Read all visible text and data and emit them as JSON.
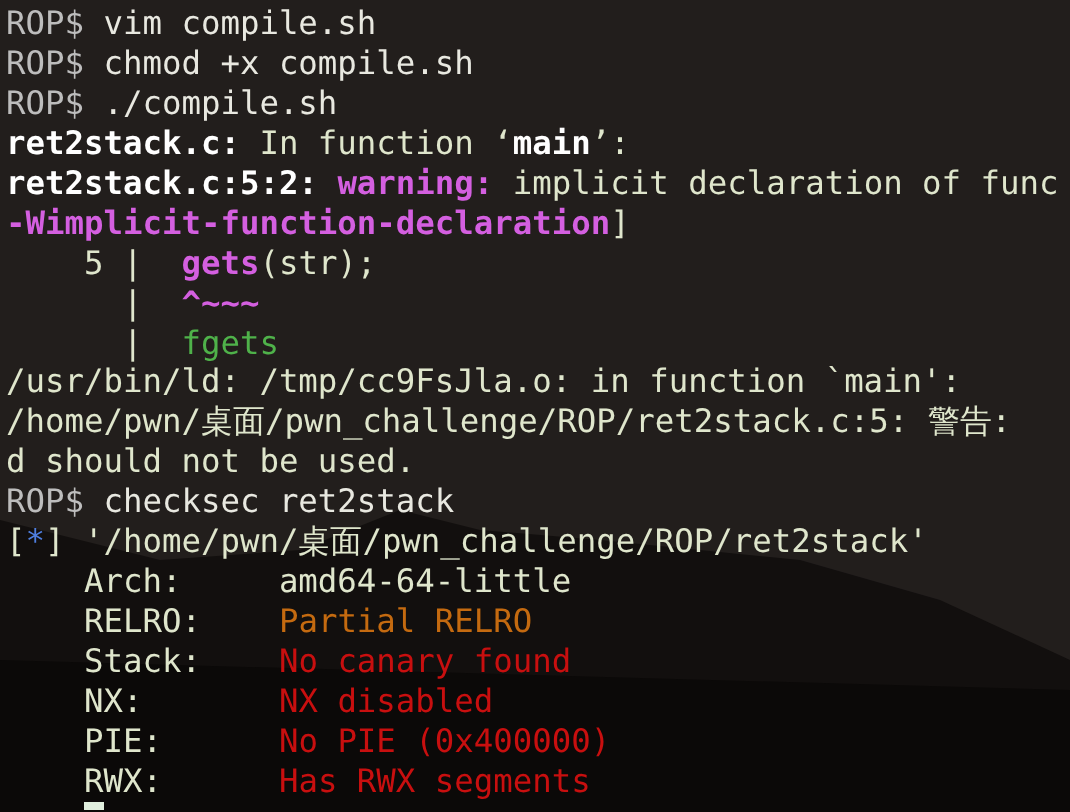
{
  "terminal": {
    "cursor": true,
    "lines": [
      [
        {
          "kind": "prompt",
          "text": "ROP$"
        },
        {
          "kind": "cmd",
          "text": " vim compile.sh"
        }
      ],
      [
        {
          "kind": "prompt",
          "text": "ROP$"
        },
        {
          "kind": "cmd",
          "text": " chmod +x compile.sh"
        }
      ],
      [
        {
          "kind": "prompt",
          "text": "ROP$"
        },
        {
          "kind": "cmd",
          "text": " ./compile.sh"
        }
      ],
      [
        {
          "kind": "bold",
          "text": "ret2stack.c:"
        },
        {
          "kind": "plain",
          "text": " In function ‘"
        },
        {
          "kind": "bold",
          "text": "main"
        },
        {
          "kind": "plain",
          "text": "’:"
        }
      ],
      [
        {
          "kind": "bold",
          "text": "ret2stack.c:5:2: "
        },
        {
          "kind": "warning",
          "text": "warning:"
        },
        {
          "kind": "plain",
          "text": " implicit declaration of func"
        }
      ],
      [
        {
          "kind": "warning",
          "text": "-Wimplicit-function-declaration"
        },
        {
          "kind": "plain",
          "text": "]"
        }
      ],
      [
        {
          "kind": "plain",
          "text": "    5 |  "
        },
        {
          "kind": "warning",
          "text": "gets"
        },
        {
          "kind": "plain",
          "text": "(str);"
        }
      ],
      [
        {
          "kind": "plain",
          "text": "      |  "
        },
        {
          "kind": "warning",
          "text": "^~~~"
        }
      ],
      [
        {
          "kind": "plain",
          "text": "      |  "
        },
        {
          "kind": "green",
          "text": "fgets"
        }
      ],
      [
        {
          "kind": "plain",
          "text": "/usr/bin/ld: /tmp/cc9FsJla.o: in function `main':"
        }
      ],
      [
        {
          "kind": "plain",
          "text": "/home/pwn/桌面/pwn_challenge/ROP/ret2stack.c:5: 警告:"
        }
      ],
      [
        {
          "kind": "plain",
          "text": "d should not be used."
        }
      ],
      [
        {
          "kind": "prompt",
          "text": "ROP$"
        },
        {
          "kind": "cmd",
          "text": " checksec ret2stack"
        }
      ],
      [
        {
          "kind": "plain",
          "text": "["
        },
        {
          "kind": "blue",
          "text": "*"
        },
        {
          "kind": "plain",
          "text": "] '/home/pwn/桌面/pwn_challenge/ROP/ret2stack'"
        }
      ],
      [
        {
          "kind": "plain",
          "text": "    Arch:     amd64-64-little"
        }
      ],
      [
        {
          "kind": "plain",
          "text": "    RELRO:    "
        },
        {
          "kind": "orange",
          "text": "Partial RELRO"
        }
      ],
      [
        {
          "kind": "plain",
          "text": "    Stack:    "
        },
        {
          "kind": "red",
          "text": "No canary found"
        }
      ],
      [
        {
          "kind": "plain",
          "text": "    NX:       "
        },
        {
          "kind": "red",
          "text": "NX disabled"
        }
      ],
      [
        {
          "kind": "plain",
          "text": "    PIE:      "
        },
        {
          "kind": "red",
          "text": "No PIE (0x400000)"
        }
      ],
      [
        {
          "kind": "plain",
          "text": "    RWX:      "
        },
        {
          "kind": "red",
          "text": "Has RWX segments"
        }
      ]
    ]
  }
}
